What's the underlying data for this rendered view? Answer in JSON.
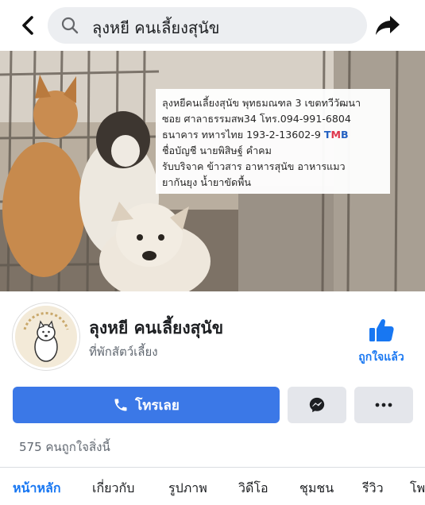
{
  "search": {
    "query": "ลุงหยี คนเลี้ยงสุนัข"
  },
  "cover": {
    "info_lines": [
      "ลุงหยีคนเลี้ยงสุนัข พุทธมณฑล 3 เขตทวีวัฒนา",
      "ซอย ศาลาธรรมสพ34 โทร.094-991-6804",
      "ธนาคาร ทหารไทย 193-2-13602-9",
      "ชื่อบัญชี นายพิสิษฐ์ คำคม",
      "รับบริจาค ข้าวสาร อาหารสุนัข อาหารแมว",
      "ยากันยุง น้ำยาขัดพื้น"
    ],
    "bank_logo": "TMB"
  },
  "profile": {
    "name": "ลุงหยี คนเลี้ยงสุนัข",
    "category": "ที่พักสัตว์เลี้ยง",
    "like_label": "ถูกใจแล้ว"
  },
  "actions": {
    "call_label": "โทรเลย"
  },
  "likes_text": "575 คนถูกใจสิ่งนี้",
  "tabs": [
    "หน้าหลัก",
    "เกี่ยวกับ",
    "รูปภาพ",
    "วิดีโอ",
    "ชุมชน",
    "รีวิว",
    "โพ"
  ],
  "colors": {
    "accent": "#1877f2",
    "call_button": "#3b78e7",
    "secondary_button": "#e4e6eb"
  },
  "icons": [
    "back-icon",
    "search-icon",
    "share-icon",
    "thumbs-up-icon",
    "phone-icon",
    "messenger-icon",
    "more-icon"
  ]
}
